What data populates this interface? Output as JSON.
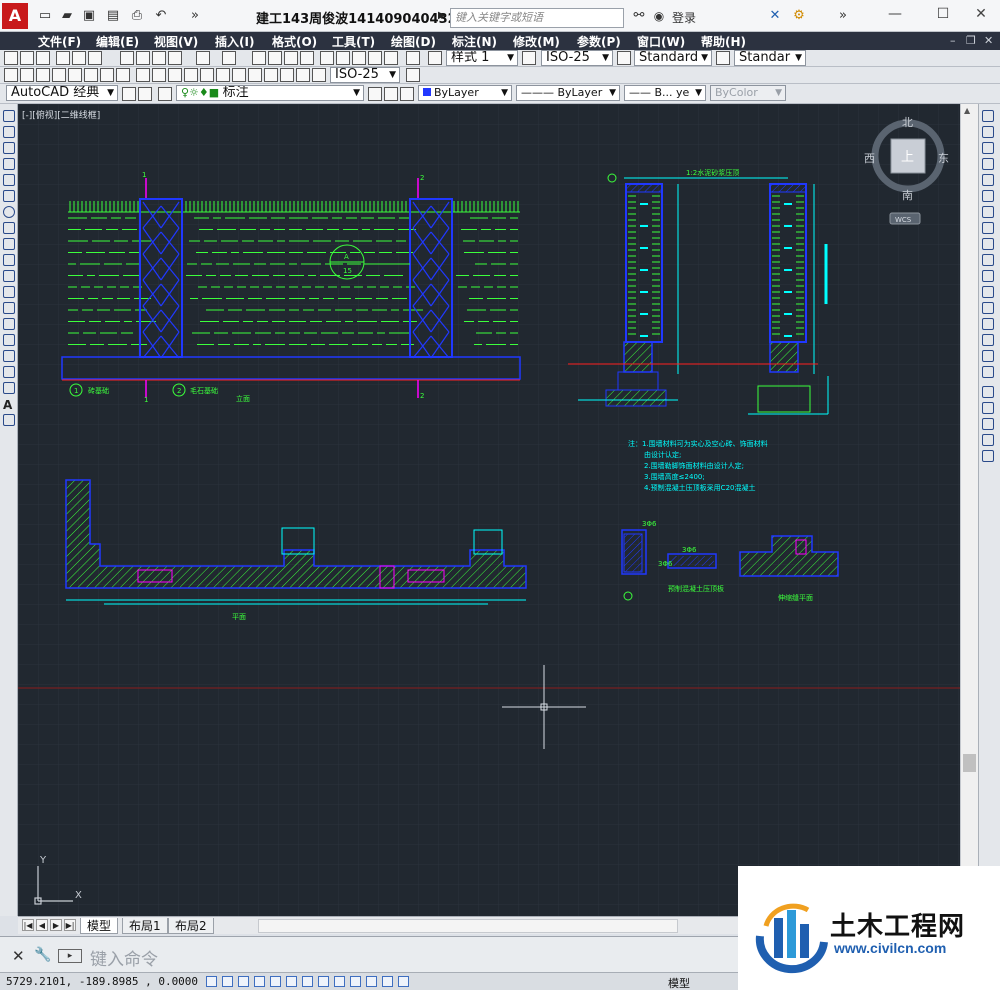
{
  "titlebar": {
    "app_button": "A",
    "title": "建工143周俊波141409040432....",
    "search_placeholder": "键入关键字或短语",
    "login": "登录"
  },
  "menu": {
    "items": [
      "文件(F)",
      "编辑(E)",
      "视图(V)",
      "插入(I)",
      "格式(O)",
      "工具(T)",
      "绘图(D)",
      "标注(N)",
      "修改(M)",
      "参数(P)",
      "窗口(W)",
      "帮助(H)"
    ]
  },
  "toolbar": {
    "text_style": "样式 1",
    "dim_style": "ISO-25",
    "table_style": "Standard",
    "multileader_style": "Standar",
    "dim_style_2": "ISO-25",
    "workspace": "AutoCAD 经典",
    "layer": "标注",
    "color": "ByLayer",
    "linetype": "ByLayer",
    "lineweight": "B... ye",
    "plot_style": "ByColor"
  },
  "viewport": {
    "label": "[-][俯视][二维线框]",
    "viewcube": {
      "top": "上",
      "north": "北",
      "south": "南",
      "east": "东",
      "west": "西",
      "wcs": "WCS"
    },
    "ucs": {
      "x": "X",
      "y": "Y"
    }
  },
  "drawing": {
    "elevation_title": "立面",
    "plan_title": "平面",
    "marker_1": "1",
    "marker_2": "2",
    "foundation_1": "砖基础",
    "foundation_2": "毛石基础",
    "section_a": "A",
    "section_15": "15",
    "coping_note": "1:2水泥砂浆压顶",
    "notes": [
      "注：1.围墙材料可为实心及空心砖、饰面材料",
      "由设计认定;",
      "2.围墙勒脚饰面材料由设计人定;",
      "3.围墙高度≤2400;",
      "4.预制混凝土压顶板采用C20混凝土"
    ],
    "detail_label_1": "预制混凝土压顶板",
    "detail_label_2": "伸缩缝平面",
    "dim_a": "3Φ6",
    "dim_b": "3Φ6",
    "dim_c": "3Φ6"
  },
  "tabs": {
    "items": [
      "模型",
      "布局1",
      "布局2"
    ],
    "active": "模型"
  },
  "commandline": {
    "placeholder": "键入命令"
  },
  "statusbar": {
    "coords": "5729.2101, -189.8985 , 0.0000",
    "model": "模型"
  },
  "watermark": {
    "name": "土木工程网",
    "url": "www.civilcn.com"
  },
  "colors": {
    "canvas": "#212830",
    "cad_blue": "#2038ff",
    "cad_green": "#3cff3c",
    "cad_cyan": "#00ffff",
    "cad_red": "#ff2020",
    "cad_magenta": "#ff00ff"
  }
}
